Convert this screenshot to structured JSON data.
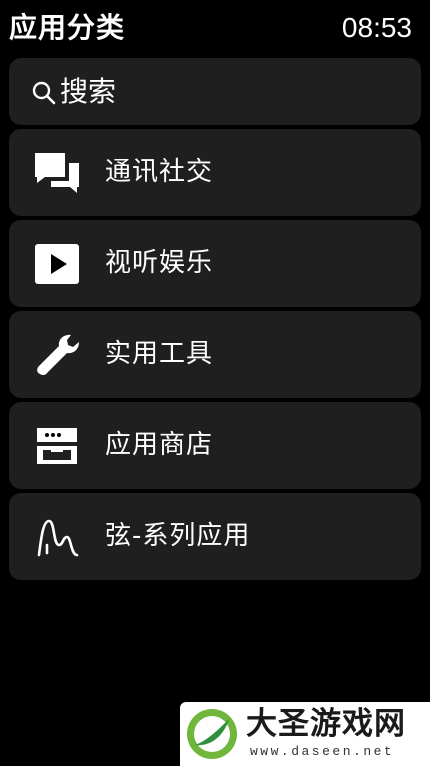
{
  "header": {
    "title": "应用分类",
    "time": "08:53"
  },
  "search": {
    "label": "搜索",
    "icon": "search-icon"
  },
  "menu": {
    "items": [
      {
        "label": "通讯社交",
        "icon": "chat-bubbles-icon"
      },
      {
        "label": "视听娱乐",
        "icon": "play-icon"
      },
      {
        "label": "实用工具",
        "icon": "wrench-icon"
      },
      {
        "label": "应用商店",
        "icon": "store-icon"
      },
      {
        "label": "弦-系列应用",
        "icon": "waveform-logo-icon"
      }
    ]
  },
  "watermark": {
    "title": "大圣游戏网",
    "url": "www.daseen.net"
  },
  "colors": {
    "background": "#000000",
    "card": "#1f1f1f",
    "text": "#ffffff"
  }
}
